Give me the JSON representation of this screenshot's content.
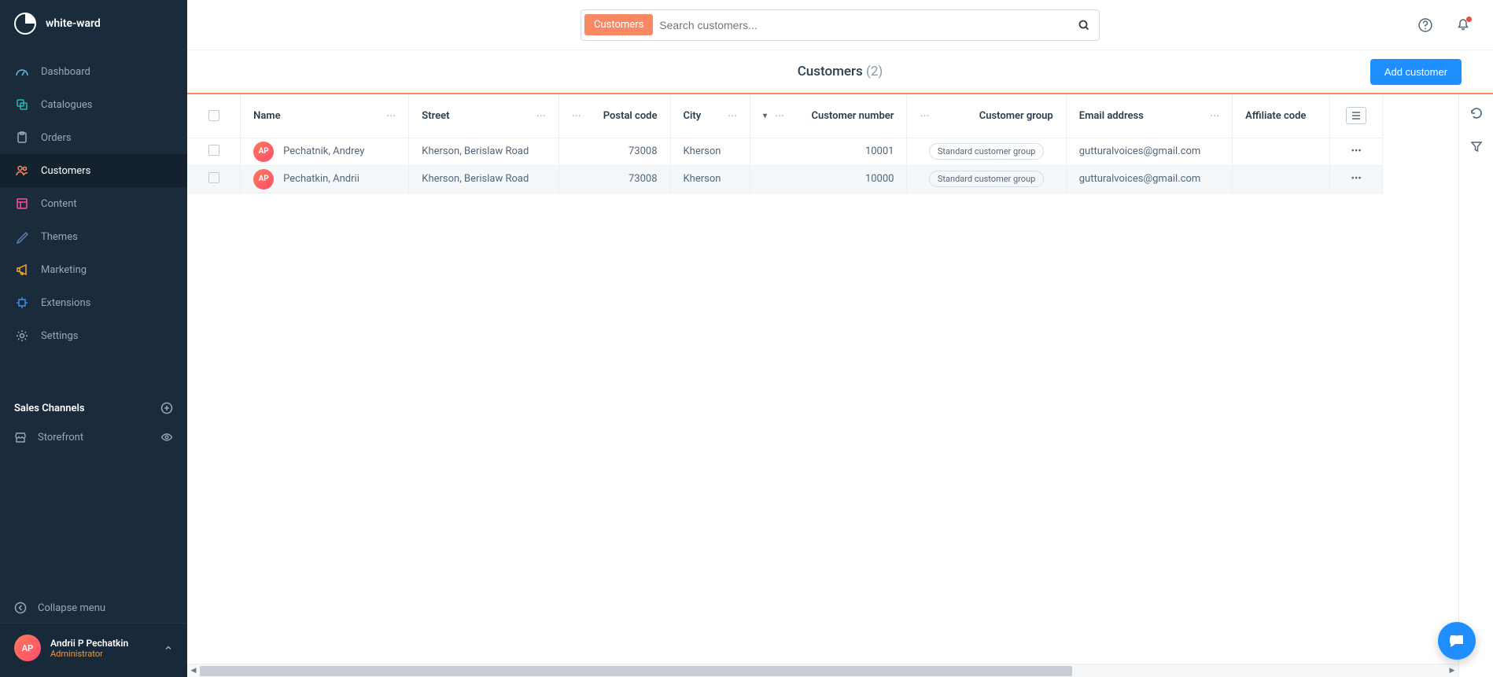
{
  "brand": {
    "name": "white-ward"
  },
  "sidebar": {
    "items": [
      {
        "label": "Dashboard",
        "icon": "speedometer-icon",
        "color": "#5bbde0"
      },
      {
        "label": "Catalogues",
        "icon": "copy-icon",
        "color": "#2ab7b7"
      },
      {
        "label": "Orders",
        "icon": "clipboard-icon",
        "color": "#9ba8b5"
      },
      {
        "label": "Customers",
        "icon": "users-icon",
        "color": "#f88962",
        "active": true
      },
      {
        "label": "Content",
        "icon": "layout-icon",
        "color": "#ff4d9d"
      },
      {
        "label": "Themes",
        "icon": "brush-icon",
        "color": "#5b7fb0"
      },
      {
        "label": "Marketing",
        "icon": "megaphone-icon",
        "color": "#f6a623"
      },
      {
        "label": "Extensions",
        "icon": "plugin-icon",
        "color": "#3a8ee6"
      },
      {
        "label": "Settings",
        "icon": "gear-icon",
        "color": "#9ba8b5"
      }
    ],
    "section_title": "Sales Channels",
    "channels": [
      {
        "label": "Storefront"
      }
    ],
    "collapse_label": "Collapse menu"
  },
  "user": {
    "initials": "AP",
    "name": "Andrii P Pechatkin",
    "role": "Administrator"
  },
  "search": {
    "tag": "Customers",
    "placeholder": "Search customers..."
  },
  "page": {
    "title": "Customers",
    "count": "(2)",
    "add_button": "Add customer"
  },
  "table": {
    "columns": {
      "name": "Name",
      "street": "Street",
      "postal_code": "Postal code",
      "city": "City",
      "customer_number": "Customer number",
      "customer_group": "Customer group",
      "email": "Email address",
      "affiliate_code": "Affiliate code"
    },
    "rows": [
      {
        "initials": "AP",
        "name": "Pechatnik, Andrey",
        "street": "Kherson, Berislaw Road",
        "postal_code": "73008",
        "city": "Kherson",
        "customer_number": "10001",
        "customer_group": "Standard customer group",
        "email": "gutturalvoices@gmail.com",
        "affiliate_code": ""
      },
      {
        "initials": "AP",
        "name": "Pechatkin, Andrii",
        "street": "Kherson, Berislaw Road",
        "postal_code": "73008",
        "city": "Kherson",
        "customer_number": "10000",
        "customer_group": "Standard customer group",
        "email": "gutturalvoices@gmail.com",
        "affiliate_code": ""
      }
    ]
  }
}
